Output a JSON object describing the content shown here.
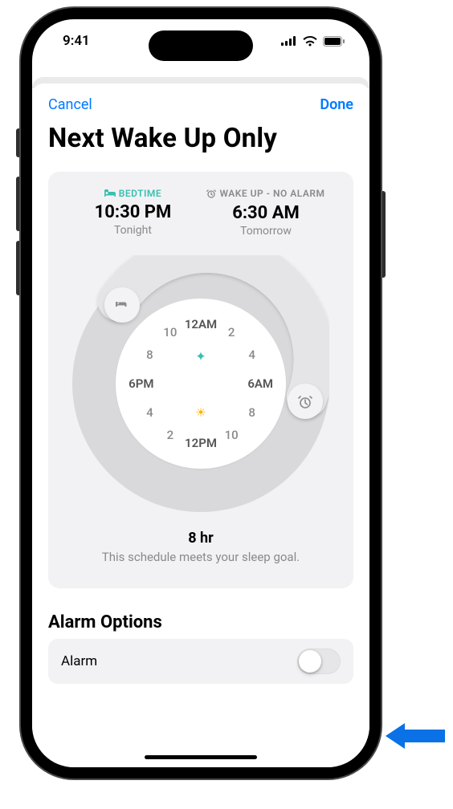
{
  "status": {
    "time": "9:41"
  },
  "nav": {
    "cancel": "Cancel",
    "done": "Done"
  },
  "title": "Next Wake Up Only",
  "bedtime": {
    "label": "BEDTIME",
    "time": "10:30 PM",
    "sub": "Tonight"
  },
  "wake": {
    "label": "WAKE UP - NO ALARM",
    "time": "6:30 AM",
    "sub": "Tomorrow"
  },
  "clock": {
    "top": "12AM",
    "bottom": "12PM",
    "left": "6PM",
    "right": "6AM",
    "h2": "2",
    "h4": "4",
    "h8": "8",
    "h10": "10"
  },
  "duration": "8 hr",
  "goal_text": "This schedule meets your sleep goal.",
  "alarm_section": "Alarm Options",
  "alarm_row": {
    "label": "Alarm",
    "on": false
  },
  "colors": {
    "accent": "#007aff",
    "teal": "#39bfb0"
  }
}
